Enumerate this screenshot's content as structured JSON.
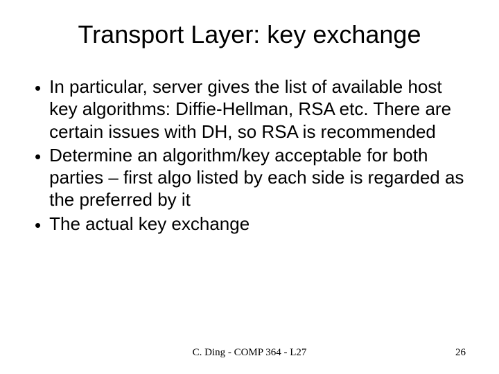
{
  "slide": {
    "title": "Transport Layer: key exchange",
    "bullets": [
      "In particular, server gives the list of available host key algorithms: Diffie-Hellman, RSA etc. There are certain issues with DH, so RSA is recommended",
      "Determine an algorithm/key acceptable for both parties – first algo listed by each side is regarded as the preferred by it",
      "The actual key exchange"
    ],
    "footer": {
      "center": "C. Ding - COMP 364 - L27",
      "page": "26"
    }
  }
}
